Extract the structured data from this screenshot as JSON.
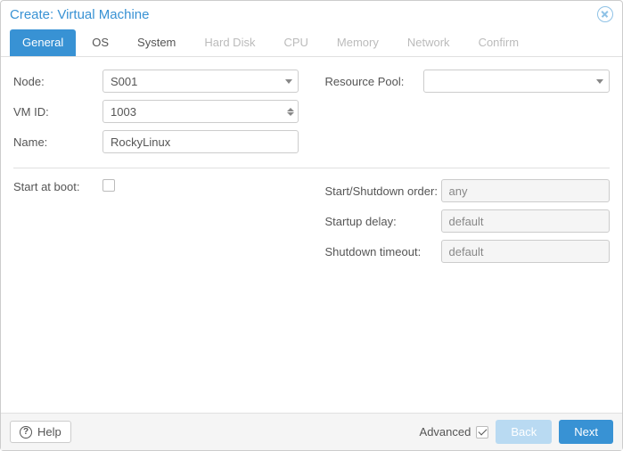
{
  "window": {
    "title": "Create: Virtual Machine"
  },
  "tabs": [
    {
      "label": "General",
      "state": "active"
    },
    {
      "label": "OS",
      "state": "enabled"
    },
    {
      "label": "System",
      "state": "enabled"
    },
    {
      "label": "Hard Disk",
      "state": "disabled"
    },
    {
      "label": "CPU",
      "state": "disabled"
    },
    {
      "label": "Memory",
      "state": "disabled"
    },
    {
      "label": "Network",
      "state": "disabled"
    },
    {
      "label": "Confirm",
      "state": "disabled"
    }
  ],
  "general": {
    "node": {
      "label": "Node:",
      "value": "S001"
    },
    "vmid": {
      "label": "VM ID:",
      "value": "1003"
    },
    "name": {
      "label": "Name:",
      "value": "RockyLinux"
    },
    "pool": {
      "label": "Resource Pool:",
      "value": ""
    }
  },
  "advanced": {
    "startAtBoot": {
      "label": "Start at boot:",
      "checked": false
    },
    "order": {
      "label": "Start/Shutdown order:",
      "value": "any"
    },
    "startupDelay": {
      "label": "Startup delay:",
      "value": "default"
    },
    "shutdownTimeout": {
      "label": "Shutdown timeout:",
      "value": "default"
    }
  },
  "footer": {
    "help": "Help",
    "advancedLabel": "Advanced",
    "advancedChecked": true,
    "back": "Back",
    "next": "Next"
  }
}
